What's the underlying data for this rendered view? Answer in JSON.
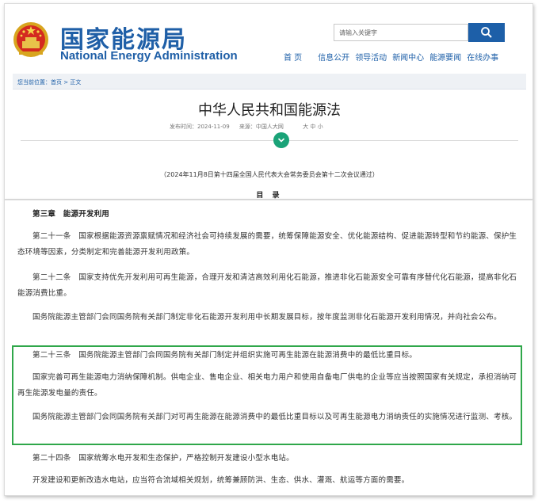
{
  "header": {
    "brand_cn": "国家能源局",
    "brand_en": "National Energy Administration",
    "search_placeholder": "请输入关键字",
    "nav": [
      "首 页",
      "信息公开",
      "领导活动",
      "新闻中心",
      "能源要闻",
      "在线办事"
    ]
  },
  "breadcrumb": "您当前位置：首页 > 正文",
  "article": {
    "title": "中华人民共和国能源法",
    "publish_time": "发布时间：2024-11-09",
    "source": "来源：中国人大网",
    "font_size": "大  中  小",
    "session_note": "（2024年11月8日第十四届全国人民代表大会常务委员会第十二次会议通过）",
    "toc_label": "目 录"
  },
  "body": {
    "chapter": "第三章　能源开发利用",
    "paragraphs": [
      "第二十一条　国家根据能源资源禀赋情况和经济社会可持续发展的需要，统筹保障能源安全、优化能源结构、促进能源转型和节约能源、保护生态环境等因素，分类制定和完善能源开发利用政策。",
      "第二十二条　国家支持优先开发利用可再生能源，合理开发和清洁高效利用化石能源，推进非化石能源安全可靠有序替代化石能源，提高非化石能源消费比重。",
      "国务院能源主管部门会同国务院有关部门制定非化石能源开发利用中长期发展目标，按年度监测非化石能源开发利用情况，并向社会公布。",
      "第二十三条　国务院能源主管部门会同国务院有关部门制定并组织实施可再生能源在能源消费中的最低比重目标。",
      "国家完善可再生能源电力消纳保障机制。供电企业、售电企业、相关电力用户和使用自备电厂供电的企业等应当按照国家有关规定，承担消纳可再生能源发电量的责任。",
      "国务院能源主管部门会同国务院有关部门对可再生能源在能源消费中的最低比重目标以及可再生能源电力消纳责任的实施情况进行监测、考核。",
      "第二十四条　国家统筹水电开发和生态保护，严格控制开发建设小型水电站。",
      "开发建设和更新改造水电站，应当符合流域相关规划，统筹兼顾防洪、生态、供水、灌溉、航运等方面的需要。"
    ]
  },
  "colors": {
    "brand_blue": "#1f5fa7",
    "highlight_green": "#2fa74a",
    "toggle_green": "#1aa378"
  }
}
